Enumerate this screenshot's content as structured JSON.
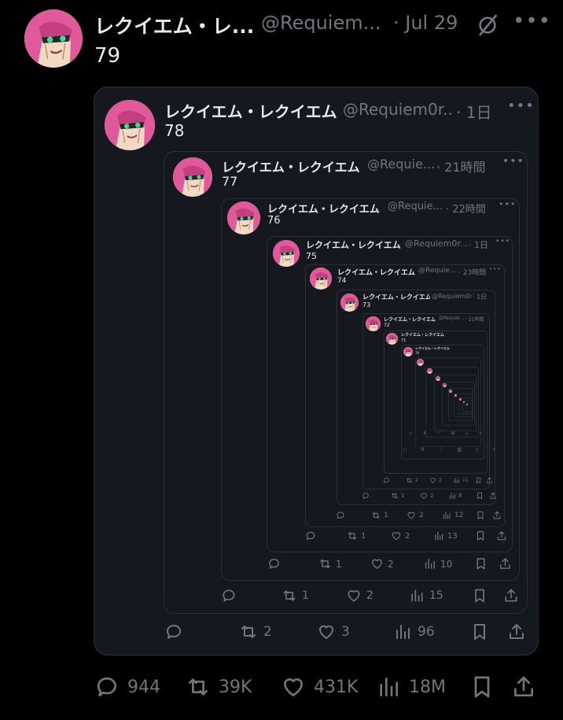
{
  "tweet": {
    "author_name": "レクイエム・レ...",
    "handle": "@Requiem...",
    "time": "· Jul 29",
    "text": "79",
    "stats": {
      "replies": "944",
      "retweets": "39K",
      "likes": "431K",
      "views": "18M"
    }
  },
  "quotes": [
    {
      "name": "レクイエム・レクイエム",
      "handle": "@Requiem0r...",
      "time": "· 1日",
      "text": "78",
      "stats": {
        "replies": "",
        "retweets": "2",
        "likes": "3",
        "views": "96"
      }
    },
    {
      "name": "レクイエム・レクイエム",
      "handle": "@Requie...",
      "time": "· 21時間",
      "text": "77",
      "stats": {
        "replies": "",
        "retweets": "1",
        "likes": "2",
        "views": "15"
      }
    },
    {
      "name": "レクイエム・レクイエム",
      "handle": "@Requie...",
      "time": "· 22時間",
      "text": "76",
      "stats": {
        "replies": "",
        "retweets": "1",
        "likes": "2",
        "views": "10"
      }
    },
    {
      "name": "レクイエム・レクイエム",
      "handle": "@Requiem0r...",
      "time": "· 1日",
      "text": "75",
      "stats": {
        "replies": "",
        "retweets": "1",
        "likes": "2",
        "views": "13"
      }
    },
    {
      "name": "レクイエム・レクイエム",
      "handle": "@Requie...",
      "time": "· 23時間",
      "text": "74",
      "stats": {
        "replies": "",
        "retweets": "1",
        "likes": "2",
        "views": "12"
      }
    },
    {
      "name": "レクイエム・レクイエム",
      "handle": "@Requiem0r...",
      "time": "· 1日",
      "text": "73",
      "stats": {
        "replies": "",
        "retweets": "1",
        "likes": "2",
        "views": "8"
      }
    },
    {
      "name": "レクイエム・レクイエム",
      "handle": "@Requie...",
      "time": "· 21時間",
      "text": "72",
      "stats": {
        "replies": "",
        "retweets": "2",
        "likes": "2",
        "views": "11"
      }
    },
    {
      "name": "レクイエム・レクイエム",
      "handle": "@Requiem0r...",
      "time": "· 1日",
      "text": "71"
    },
    {
      "name": "レクイエム・レクイエム",
      "handle": "@Requie...",
      "time": "· 21時間",
      "text": "70"
    }
  ],
  "colors": {
    "background": "#000000",
    "card": "#15191f",
    "muted": "#71767b",
    "text": "#e7e9ea",
    "avatar_hair": "#e05a9b"
  }
}
